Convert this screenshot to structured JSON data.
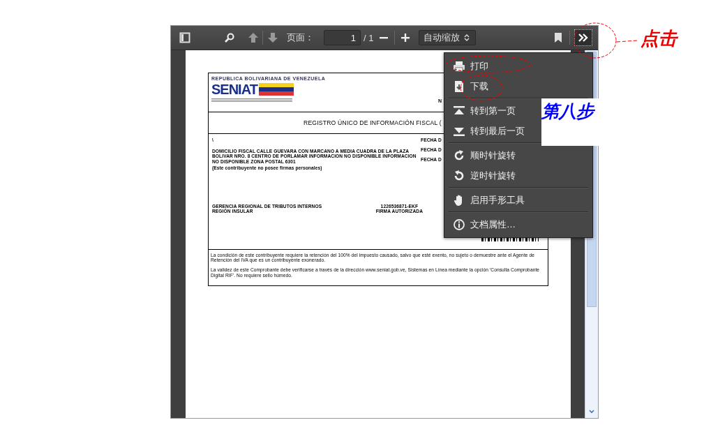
{
  "toolbar": {
    "page_label": "页面：",
    "page_value": "1",
    "page_total": "/ 1",
    "zoom": "自动缩放"
  },
  "document": {
    "republic": "REPUBLICA BOLIVARIANA DE VENEZUELA",
    "logo": "SENIAT",
    "header_mark": "N",
    "title": "REGISTRO ÚNICO DE INFORMACIÓN FISCAL (",
    "mark": "\\",
    "address": "DOMICILIO FISCAL  CALLE GUEVARA CON MARCANO A MEDIA CUADRA DE LA PLAZA BOLIVAR NRO. 8 CENTRO DE PORLAMAR INFORMACION NO DISPONIBLE INFORMACION NO DISPONIBLE ZONA POSTAL 6301",
    "signatures": "(Este contribuyente no posee firmas personales)",
    "date_labels": [
      "FECHA D",
      "FECHA D",
      "FECHA D"
    ],
    "office": [
      "GERENCIA REGIONAL DE TRIBUTOS INTERNOS",
      "REGIÓN INSULAR"
    ],
    "signature": [
      "1226536871-EKF",
      "FIRMA AUTORIZADA"
    ],
    "notes": [
      "La condición de este contribuyente requiere la retención del 100% del impuesto causado, salvo que esté exento, no sujeto o demuestre ante el Agente de Retención del IVA que es un contribuyente exonerado.",
      "La validez de este Comprobante debe verificarse a través de la dirección www.seniat.gob.ve, Sistemas en Línea mediante la opción 'Consulta Comprobante Digital RIF'. No requiere sello húmedo."
    ]
  },
  "menu": {
    "groups": [
      [
        {
          "kind": "print",
          "label": "打印"
        },
        {
          "kind": "download",
          "label": "下载"
        }
      ],
      [
        {
          "kind": "first",
          "label": "转到第一页"
        },
        {
          "kind": "last",
          "label": "转到最后一页"
        }
      ],
      [
        {
          "kind": "cw",
          "label": "顺时针旋转"
        },
        {
          "kind": "ccw",
          "label": "逆时针旋转"
        }
      ],
      [
        {
          "kind": "hand",
          "label": "启用手形工具"
        }
      ],
      [
        {
          "kind": "info",
          "label": "文档属性…"
        }
      ]
    ]
  },
  "annotations": {
    "click": "点击",
    "step": "第八步"
  }
}
